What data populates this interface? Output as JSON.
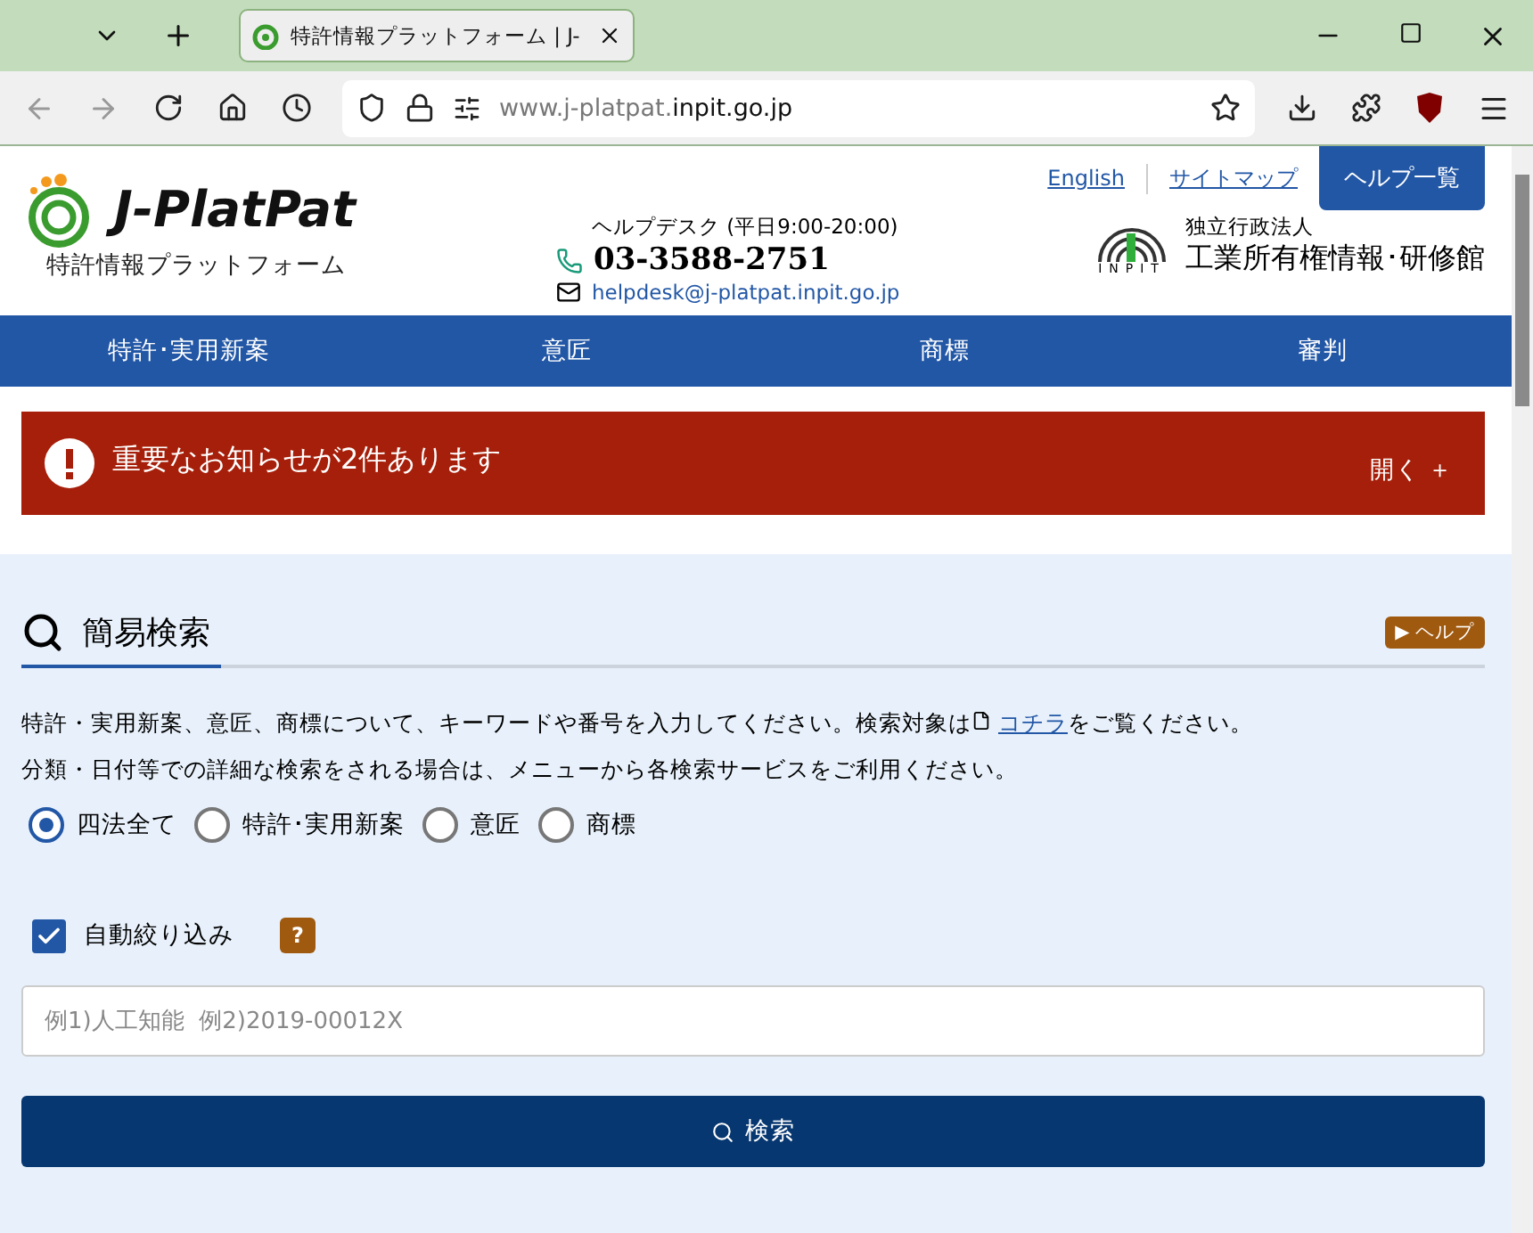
{
  "browser": {
    "tab_title": "特許情報プラットフォーム | J-",
    "url_host_prefix": "www.j-platpat.",
    "url_host_main": "inpit.go.jp"
  },
  "header": {
    "logo_name": "J-PlatPat",
    "logo_subtitle": "特許情報プラットフォーム",
    "links": [
      {
        "label": "English"
      },
      {
        "label": "サイトマップ"
      }
    ],
    "help_button": "ヘルプ一覧",
    "helpdesk_label": "ヘルプデスク (平日9:00-20:00)",
    "phone": "03-3588-2751",
    "email": "helpdesk@j-platpat.inpit.go.jp",
    "org_mark": "INPIT",
    "org_type": "独立行政法人",
    "org_name": "工業所有権情報･研修館"
  },
  "nav": [
    {
      "label": "特許･実用新案"
    },
    {
      "label": "意匠"
    },
    {
      "label": "商標"
    },
    {
      "label": "審判"
    }
  ],
  "notice": {
    "message": "重要なお知らせが2件あります",
    "toggle": "開く ＋"
  },
  "search": {
    "title": "簡易検索",
    "help_marker": "▶",
    "help": "ヘルプ",
    "intro_before": "特許・実用新案、意匠、商標について、キーワードや番号を入力してください。検索対象は",
    "intro_link": "コチラ",
    "intro_after": "をご覧ください。",
    "intro_line2": "分類・日付等での詳細な検索をされる場合は、メニューから各検索サービスをご利用ください。",
    "scopes": [
      {
        "label": "四法全て",
        "selected": true
      },
      {
        "label": "特許･実用新案",
        "selected": false
      },
      {
        "label": "意匠",
        "selected": false
      },
      {
        "label": "商標",
        "selected": false
      }
    ],
    "auto_narrow": {
      "label": "自動絞り込み",
      "checked": true,
      "hint": "?"
    },
    "placeholder": "例1)人工知能  例2)2019-00012X",
    "button": "検索"
  }
}
